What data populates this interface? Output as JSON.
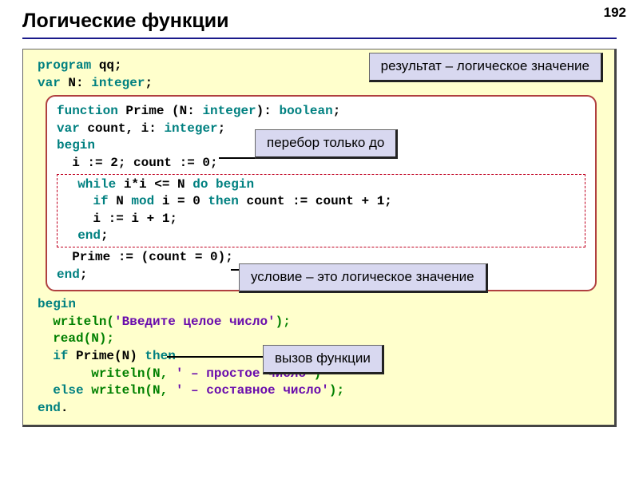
{
  "page_number": "192",
  "title": "Логические функции",
  "code": {
    "l1a": "program",
    "l1b": " qq;",
    "l2a": "var",
    "l2b": " N: ",
    "l2c": "integer",
    "l2d": ";",
    "func": {
      "f1a": "function",
      "f1b": " Prime (N: ",
      "f1c": "integer",
      "f1d": "): ",
      "f1e": "boolean",
      "f1f": ";",
      "f2a": "var",
      "f2b": " count, i: ",
      "f2c": "integer",
      "f2d": ";",
      "f3": "begin",
      "f4": "  i := 2; count := 0;",
      "loop": {
        "w1a": "  ",
        "w1b": "while",
        "w1c": " i*i <= N ",
        "w1d": "do begin",
        "w2a": "    ",
        "w2b": "if",
        "w2c": " N ",
        "w2d": "mod",
        "w2e": " i = 0 ",
        "w2f": "then",
        "w2g": " count := count + 1;",
        "w3": "    i := i + 1;",
        "w4a": "  ",
        "w4b": "end",
        "w4c": ";"
      },
      "f5": "  Prime := (count = 0);",
      "f6a": "end",
      "f6b": ";"
    },
    "m1": "begin",
    "m2a": "  writeln(",
    "m2b": "'Введите целое число'",
    "m2c": ");",
    "m3": "  read(N);",
    "m4a": "  ",
    "m4b": "if",
    "m4c": " Prime(N) ",
    "m4d": "then",
    "m5a": "       writeln(N, ",
    "m5b": "' – простое число'",
    "m5c": ")",
    "m6a": "  ",
    "m6b": "else",
    "m6c": " writeln(N, ",
    "m6d": "' – составное число'",
    "m6e": ");",
    "m7a": "end",
    "m7b": "."
  },
  "callouts": {
    "c1": "результат – логическое значение",
    "c2": "перебор только до",
    "c3": "условие – это логическое значение",
    "c4": "вызов функции"
  }
}
